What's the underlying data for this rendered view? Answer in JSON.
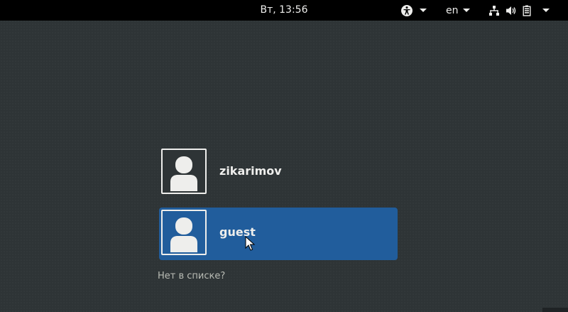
{
  "top_bar": {
    "clock": "Вт, 13:56",
    "language": "en",
    "icons": [
      "accessibility-icon",
      "network-icon",
      "volume-icon",
      "battery-icon"
    ]
  },
  "users": [
    {
      "name": "zikarimov",
      "selected": false
    },
    {
      "name": "guest",
      "selected": true
    }
  ],
  "not_listed": "Нет в списке?",
  "colors": {
    "top_bar_bg": "#000000",
    "background": "#2e3436",
    "selected_bg": "#215d9c",
    "text": "#eeeeec",
    "muted_text": "#babdb6"
  }
}
